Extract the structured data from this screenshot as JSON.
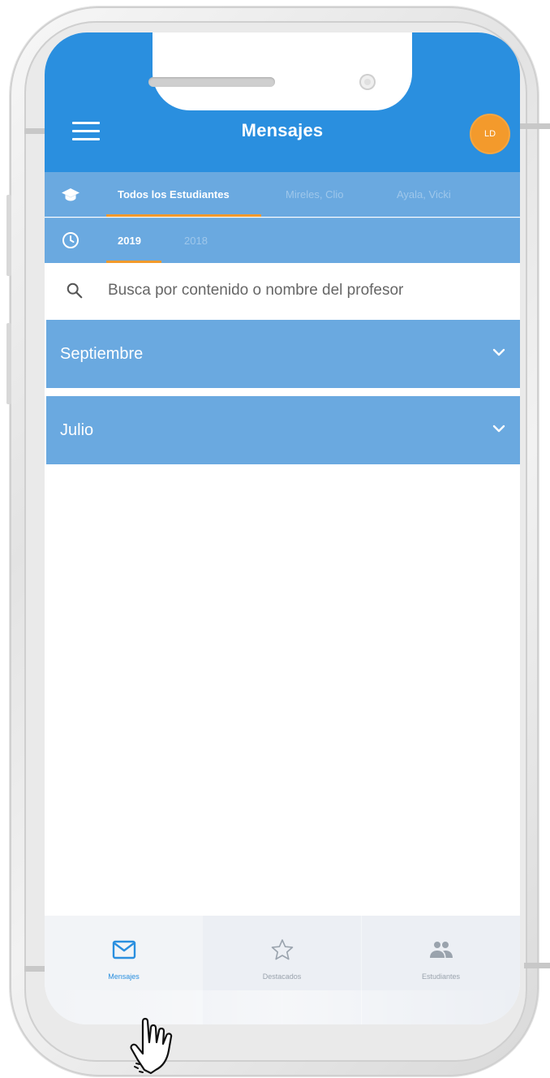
{
  "header": {
    "title": "Mensajes",
    "avatar_initials": "LD",
    "menu_icon": "hamburger-menu-icon"
  },
  "students_tabs": {
    "icon": "graduation-cap-icon",
    "items": [
      {
        "label": "Todos los Estudiantes",
        "active": true
      },
      {
        "label": "Mireles, Clio",
        "active": false
      },
      {
        "label": "Ayala, Vicki",
        "active": false
      }
    ]
  },
  "year_tabs": {
    "icon": "clock-icon",
    "items": [
      {
        "label": "2019",
        "active": true
      },
      {
        "label": "2018",
        "active": false
      }
    ]
  },
  "search": {
    "icon": "search-icon",
    "placeholder": "Busca por contenido o nombre del profesor",
    "value": ""
  },
  "months": [
    {
      "label": "Septiembre",
      "icon": "chevron-down-icon"
    },
    {
      "label": "Julio",
      "icon": "chevron-down-icon"
    }
  ],
  "bottom_nav": {
    "items": [
      {
        "label": "Mensajes",
        "icon": "mail-icon",
        "active": true
      },
      {
        "label": "Destacados",
        "icon": "star-icon",
        "active": false
      },
      {
        "label": "Estudiantes",
        "icon": "people-icon",
        "active": false
      }
    ]
  },
  "colors": {
    "primary": "#2a8fdf",
    "secondary": "#6aa9e0",
    "accent": "#f39a2c",
    "nav_inactive": "#9aa3ad"
  }
}
